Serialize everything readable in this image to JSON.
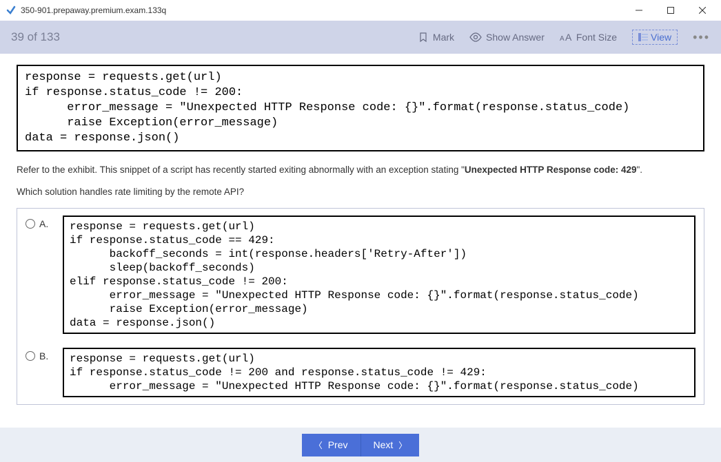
{
  "window": {
    "title": "350-901.prepaway.premium.exam.133q"
  },
  "toolbar": {
    "counter": "39 of 133",
    "mark": "Mark",
    "showAnswer": "Show Answer",
    "fontSize": "Font Size",
    "view": "View"
  },
  "exhibit": {
    "code": "response = requests.get(url)\nif response.status_code != 200:\n      error_message = \"Unexpected HTTP Response code: {}\".format(response.status_code)\n      raise Exception(error_message)\ndata = response.json()"
  },
  "question": {
    "intro_prefix": "Refer to the exhibit. This snippet of a script has recently started exiting abnormally with an exception stating \"",
    "intro_bold": "Unexpected HTTP Response code: 429",
    "intro_suffix": "\".",
    "sub": "Which solution handles rate limiting by the remote API?"
  },
  "answers": [
    {
      "label": "A.",
      "code": "response = requests.get(url)\nif response.status_code == 429:\n      backoff_seconds = int(response.headers['Retry-After'])\n      sleep(backoff_seconds)\nelif response.status_code != 200:\n      error_message = \"Unexpected HTTP Response code: {}\".format(response.status_code)\n      raise Exception(error_message)\ndata = response.json()"
    },
    {
      "label": "B.",
      "code": "response = requests.get(url)\nif response.status_code != 200 and response.status_code != 429:\n      error_message = \"Unexpected HTTP Response code: {}\".format(response.status_code)"
    }
  ],
  "footer": {
    "prev": "Prev",
    "next": "Next"
  }
}
